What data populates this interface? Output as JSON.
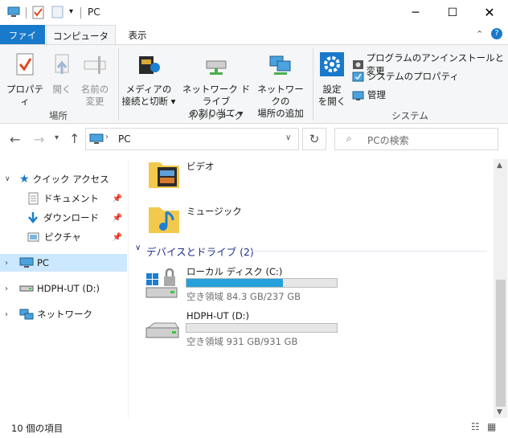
{
  "window": {
    "title": "PC"
  },
  "ribbon_tabs": {
    "file": "ファイル",
    "computer": "コンピューター",
    "view": "表示"
  },
  "ribbon": {
    "location": {
      "label": "場所",
      "properties": "プロパティ",
      "open": "開く",
      "rename": [
        "名前の",
        "変更"
      ]
    },
    "network": {
      "label": "ネットワーク",
      "media": [
        "メディアの",
        "接続と切断 ▾"
      ],
      "map_drive": [
        "ネットワーク ドライブ",
        "の割り当て ▾"
      ],
      "add_location": [
        "ネットワークの",
        "場所の追加"
      ]
    },
    "system": {
      "label": "システム",
      "settings": [
        "設定",
        "を開く"
      ],
      "uninstall": "プログラムのアンインストールと変更",
      "sys_props": "システムのプロパティ",
      "manage": "管理"
    }
  },
  "address": {
    "path": "PC",
    "search_placeholder": "PCの検索"
  },
  "nav": {
    "quick_access": "クイック アクセス",
    "documents": "ドキュメント",
    "downloads": "ダウンロード",
    "pictures": "ピクチャ",
    "pc": "PC",
    "hdph": "HDPH-UT (D:)",
    "network": "ネットワーク"
  },
  "content": {
    "folders": [
      {
        "name": "ビデオ",
        "icon": "video-folder-icon"
      },
      {
        "name": "ミュージック",
        "icon": "music-folder-icon"
      }
    ],
    "group_header": "デバイスとドライブ (2)",
    "drives": [
      {
        "name": "ローカル ディスク (C:)",
        "free": "空き領域 84.3 GB/237 GB",
        "used_fraction": 0.644
      },
      {
        "name": "HDPH-UT (D:)",
        "free": "空き領域 931 GB/931 GB",
        "used_fraction": 0.0
      }
    ]
  },
  "status": {
    "count": "10 個の項目"
  },
  "colors": {
    "accent": "#1979ca",
    "selection": "#cce8ff",
    "bar": "#26a0da"
  }
}
